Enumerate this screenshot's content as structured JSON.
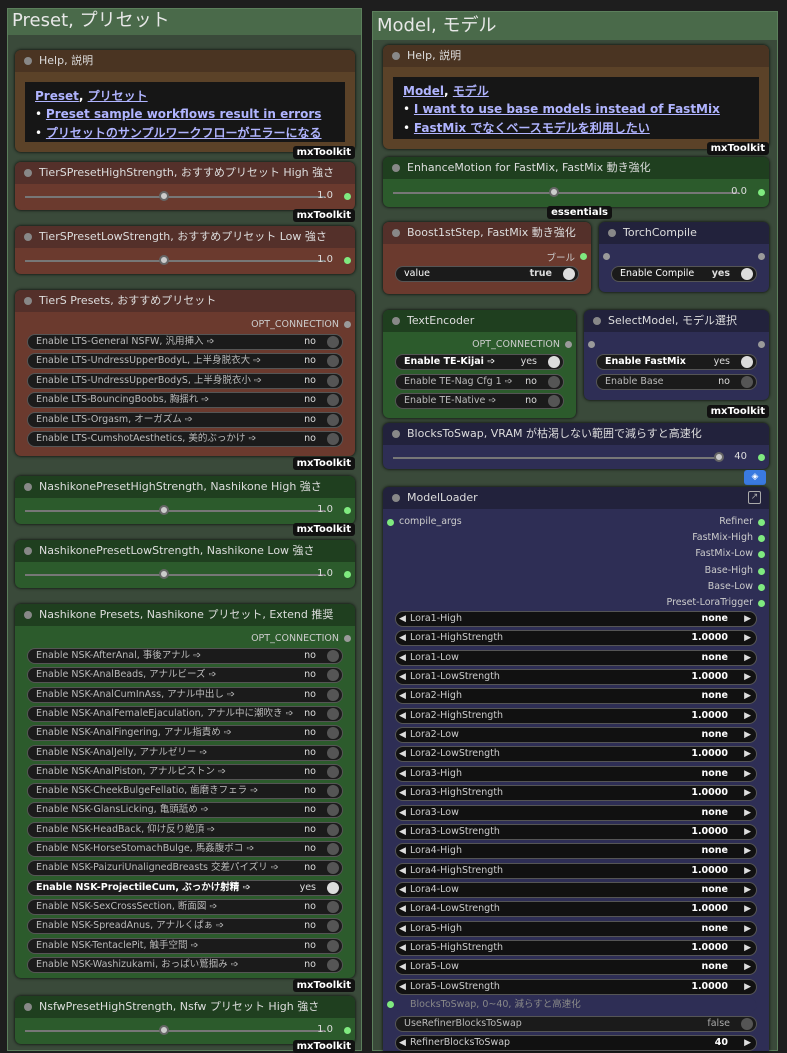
{
  "preset_group": {
    "title": "Preset, プリセット",
    "help": {
      "title": "Help, 説明",
      "heading_a": "Preset",
      "heading_sep": ", ",
      "heading_b": "プリセット",
      "links": [
        "Preset sample workflows result in errors",
        "プリセットのサンプルワークフローがエラーになる"
      ],
      "badge": "mxToolkit"
    },
    "tiers_high": {
      "title": "TierSPresetHighStrength, おすすめプリセット High 強さ",
      "value": "1.0",
      "fraction": 0.5,
      "badge": "mxToolkit"
    },
    "tiers_low": {
      "title": "TierSPresetLowStrength, おすすめプリセット Low 強さ",
      "value": "1.0",
      "fraction": 0.5
    },
    "tiers_presets": {
      "title": "TierS Presets, おすすめプリセット",
      "output": "OPT_CONNECTION",
      "badge": "mxToolkit",
      "items": [
        {
          "label": "Enable LTS-General NSFW, 汎用挿入 ➩",
          "value": "no",
          "on": false
        },
        {
          "label": "Enable LTS-UndressUpperBodyL, 上半身脱衣大 ➩",
          "value": "no",
          "on": false
        },
        {
          "label": "Enable LTS-UndressUpperBodyS, 上半身脱衣小 ➩",
          "value": "no",
          "on": false
        },
        {
          "label": "Enable LTS-BouncingBoobs, 胸揺れ ➩",
          "value": "no",
          "on": false
        },
        {
          "label": "Enable LTS-Orgasm, オーガズム ➩",
          "value": "no",
          "on": false
        },
        {
          "label": "Enable LTS-CumshotAesthetics, 美的ぶっかけ ➩",
          "value": "no",
          "on": false
        }
      ]
    },
    "nashi_high": {
      "title": "NashikonePresetHighStrength, Nashikone High 強さ",
      "value": "1.0",
      "fraction": 0.5,
      "badge": "mxToolkit"
    },
    "nashi_low": {
      "title": "NashikonePresetLowStrength, Nashikone Low 強さ",
      "value": "1.0",
      "fraction": 0.5
    },
    "nashi_presets": {
      "title": "Nashikone Presets, Nashikone プリセット, Extend 推奨",
      "output": "OPT_CONNECTION",
      "badge": "mxToolkit",
      "items": [
        {
          "label": "Enable NSK-AfterAnal, 事後アナル ➩",
          "value": "no",
          "on": false
        },
        {
          "label": "Enable NSK-AnalBeads, アナルビーズ ➩",
          "value": "no",
          "on": false
        },
        {
          "label": "Enable NSK-AnalCumInAss, アナル中出し ➩",
          "value": "no",
          "on": false
        },
        {
          "label": "Enable NSK-AnalFemaleEjaculation, アナル中に潮吹き ➩",
          "value": "no",
          "on": false
        },
        {
          "label": "Enable NSK-AnalFingering, アナル指責め ➩",
          "value": "no",
          "on": false
        },
        {
          "label": "Enable NSK-AnalJelly, アナルゼリー ➩",
          "value": "no",
          "on": false
        },
        {
          "label": "Enable NSK-AnalPiston, アナルピストン ➩",
          "value": "no",
          "on": false
        },
        {
          "label": "Enable NSK-CheekBulgeFellatio, 歯磨きフェラ ➩",
          "value": "no",
          "on": false
        },
        {
          "label": "Enable NSK-GlansLicking, 亀頭舐め ➩",
          "value": "no",
          "on": false
        },
        {
          "label": "Enable NSK-HeadBack, 仰け反り絶頂 ➩",
          "value": "no",
          "on": false
        },
        {
          "label": "Enable NSK-HorseStomachBulge, 馬姦腹ボコ ➩",
          "value": "no",
          "on": false
        },
        {
          "label": "Enable NSK-PaizuriUnalignedBreasts 交差パイズリ ➩",
          "value": "no",
          "on": false
        },
        {
          "label": "Enable NSK-ProjectileCum, ぶっかけ射精 ➩",
          "value": "yes",
          "on": true
        },
        {
          "label": "Enable NSK-SexCrossSection, 断面図 ➩",
          "value": "no",
          "on": false
        },
        {
          "label": "Enable NSK-SpreadAnus, アナルくぱぁ ➩",
          "value": "no",
          "on": false
        },
        {
          "label": "Enable NSK-TentaclePit, 触手空間 ➩",
          "value": "no",
          "on": false
        },
        {
          "label": "Enable NSK-Washizukami, おっぱい鷲掴み ➩",
          "value": "no",
          "on": false
        }
      ]
    },
    "nsfw_high": {
      "title": "NsfwPresetHighStrength, Nsfw プリセット High 強さ",
      "value": "1.0",
      "fraction": 0.5,
      "badge": "mxToolkit"
    }
  },
  "model_group": {
    "title": "Model, モデル",
    "help": {
      "title": "Help, 説明",
      "heading_a": "Model",
      "heading_sep": ", ",
      "heading_b": "モデル",
      "links": [
        "I want to use base models instead of FastMix",
        "FastMix でなくベースモデルを利用したい"
      ],
      "badge": "mxToolkit"
    },
    "enhance": {
      "title": "EnhanceMotion for FastMix, FastMix 動き強化",
      "value": "0.0",
      "fraction": 0.5,
      "badge": "essentials"
    },
    "boost": {
      "title": "Boost1stStep, FastMix 動き強化",
      "output": "ブール",
      "field": "value",
      "field_value": "true"
    },
    "torch": {
      "title": "TorchCompile",
      "field": "Enable Compile",
      "field_value": "yes"
    },
    "text_encoder": {
      "title": "TextEncoder",
      "output": "OPT_CONNECTION",
      "items": [
        {
          "label": "Enable TE-Kijai ➩",
          "value": "yes",
          "on": true
        },
        {
          "label": "Enable TE-Nag Cfg 1 ➩",
          "value": "no",
          "on": false
        },
        {
          "label": "Enable TE-Native ➩",
          "value": "no",
          "on": false
        }
      ]
    },
    "select_model": {
      "title": "SelectModel, モデル選択",
      "badge": "mxToolkit",
      "items": [
        {
          "label": "Enable FastMix",
          "value": "yes",
          "on": true
        },
        {
          "label": "Enable Base",
          "value": "no",
          "on": false
        }
      ]
    },
    "blocks": {
      "title": "BlocksToSwap, VRAM が枯渇しない範囲で減らすと高速化",
      "value": "40",
      "fraction": 1.0
    },
    "loader": {
      "title": "ModelLoader",
      "input": "compile_args",
      "outputs": [
        "Refiner",
        "FastMix-High",
        "FastMix-Low",
        "Base-High",
        "Base-Low",
        "Preset-LoraTrigger"
      ],
      "loras": [
        {
          "label": "Lora1-High",
          "value": "none"
        },
        {
          "label": "Lora1-HighStrength",
          "value": "1.0000"
        },
        {
          "label": "Lora1-Low",
          "value": "none"
        },
        {
          "label": "Lora1-LowStrength",
          "value": "1.0000"
        },
        {
          "label": "Lora2-High",
          "value": "none"
        },
        {
          "label": "Lora2-HighStrength",
          "value": "1.0000"
        },
        {
          "label": "Lora2-Low",
          "value": "none"
        },
        {
          "label": "Lora2-LowStrength",
          "value": "1.0000"
        },
        {
          "label": "Lora3-High",
          "value": "none"
        },
        {
          "label": "Lora3-HighStrength",
          "value": "1.0000"
        },
        {
          "label": "Lora3-Low",
          "value": "none"
        },
        {
          "label": "Lora3-LowStrength",
          "value": "1.0000"
        },
        {
          "label": "Lora4-High",
          "value": "none"
        },
        {
          "label": "Lora4-HighStrength",
          "value": "1.0000"
        },
        {
          "label": "Lora4-Low",
          "value": "none"
        },
        {
          "label": "Lora4-LowStrength",
          "value": "1.0000"
        },
        {
          "label": "Lora5-High",
          "value": "none"
        },
        {
          "label": "Lora5-HighStrength",
          "value": "1.0000"
        },
        {
          "label": "Lora5-Low",
          "value": "none"
        },
        {
          "label": "Lora5-LowStrength",
          "value": "1.0000"
        }
      ],
      "blocks_input": "BlocksToSwap, 0~40, 減らすと高速化",
      "use_refiner": {
        "label": "UseRefinerBlocksToSwap",
        "value": "false"
      },
      "refiner_blocks": {
        "label": "RefinerBlocksToSwap",
        "value": "40"
      }
    }
  }
}
